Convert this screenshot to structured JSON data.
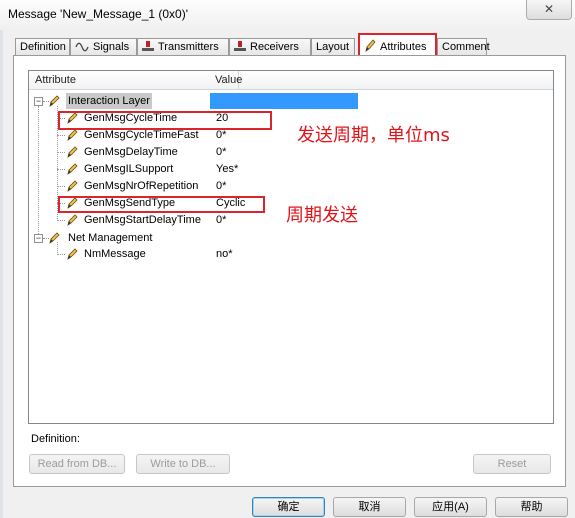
{
  "window": {
    "title": "Message 'New_Message_1 (0x0)'",
    "close_glyph": "✕"
  },
  "tabs": [
    {
      "label": "Definition",
      "icon": null
    },
    {
      "label": "Signals",
      "icon": "signals-icon"
    },
    {
      "label": "Transmitters",
      "icon": "transmitter-icon"
    },
    {
      "label": "Receivers",
      "icon": "receiver-icon"
    },
    {
      "label": "Layout",
      "icon": null
    },
    {
      "label": "Attributes",
      "icon": "pencil-icon",
      "active": true
    },
    {
      "label": "Comment",
      "icon": null
    }
  ],
  "grid": {
    "headers": {
      "attribute": "Attribute",
      "value": "Value"
    },
    "groups": [
      {
        "label": "Interaction Layer",
        "expander": "−",
        "rows": [
          {
            "name": "GenMsgCycleTime",
            "value": "20"
          },
          {
            "name": "GenMsgCycleTimeFast",
            "value": "0*"
          },
          {
            "name": "GenMsgDelayTime",
            "value": "0*"
          },
          {
            "name": "GenMsgILSupport",
            "value": "Yes*"
          },
          {
            "name": "GenMsgNrOfRepetition",
            "value": "0*"
          },
          {
            "name": "GenMsgSendType",
            "value": "Cyclic"
          },
          {
            "name": "GenMsgStartDelayTime",
            "value": "0*"
          }
        ]
      },
      {
        "label": "Net Management",
        "expander": "−",
        "rows": [
          {
            "name": "NmMessage",
            "value": "no*"
          }
        ]
      }
    ]
  },
  "annotations": {
    "cycle": "发送周期，单位ms",
    "sendtype": "周期发送"
  },
  "definition": {
    "label": "Definition:",
    "read_btn": "Read from DB...",
    "write_btn": "Write to DB...",
    "reset_btn": "Reset"
  },
  "footer": {
    "ok": "确定",
    "cancel": "取消",
    "apply": "应用(A)",
    "help": "帮助"
  },
  "colors": {
    "accent_red": "#d9252c",
    "selection_blue": "#3399ff",
    "annotation_red": "#e0141b"
  }
}
